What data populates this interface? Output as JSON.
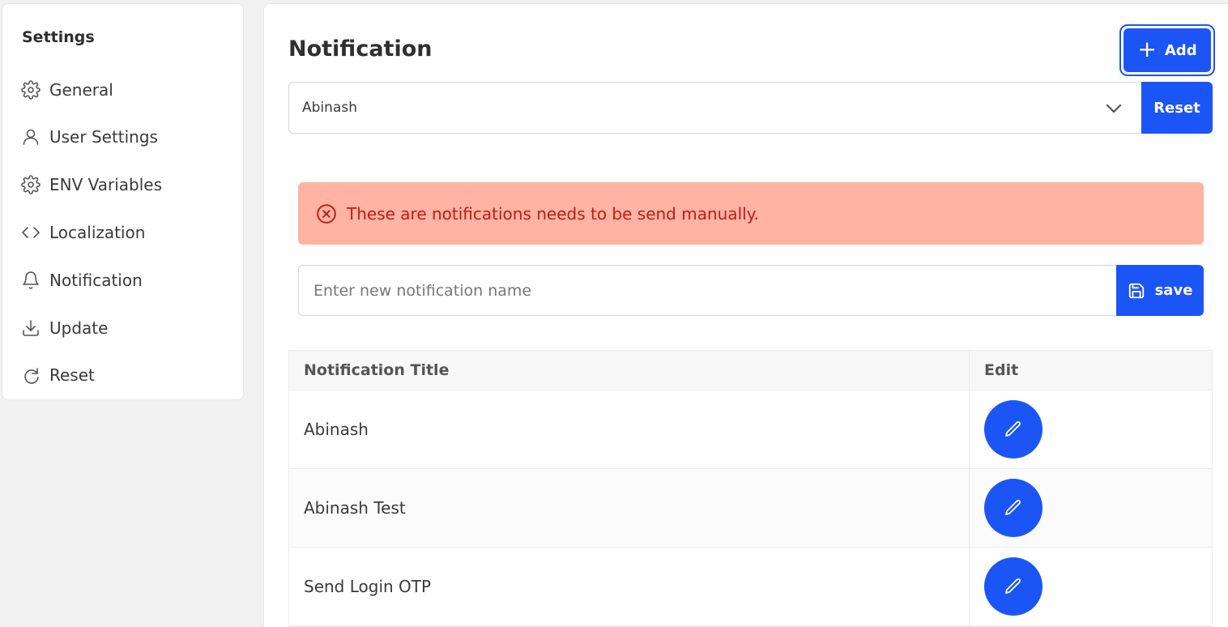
{
  "sidebar": {
    "title": "Settings",
    "items": [
      {
        "label": "General",
        "icon": "gear-icon"
      },
      {
        "label": "User Settings",
        "icon": "user-icon"
      },
      {
        "label": "ENV Variables",
        "icon": "gear-icon"
      },
      {
        "label": "Localization",
        "icon": "code-icon"
      },
      {
        "label": "Notification",
        "icon": "bell-icon"
      },
      {
        "label": "Update",
        "icon": "download-icon"
      },
      {
        "label": "Reset",
        "icon": "refresh-icon"
      }
    ]
  },
  "main": {
    "title": "Notification",
    "add_label": "Add",
    "select_value": "Abinash",
    "reset_label": "Reset",
    "alert_text": "These are notifications needs to be send manually.",
    "input_placeholder": "Enter new notification name",
    "save_label": "save",
    "table": {
      "headers": [
        "Notification Title",
        "Edit"
      ],
      "rows": [
        {
          "title": "Abinash"
        },
        {
          "title": "Abinash Test"
        },
        {
          "title": "Send Login OTP"
        }
      ]
    }
  },
  "colors": {
    "accent": "#1c55f5",
    "alert_bg": "#ffb4a3",
    "alert_text": "#c01a1a"
  }
}
